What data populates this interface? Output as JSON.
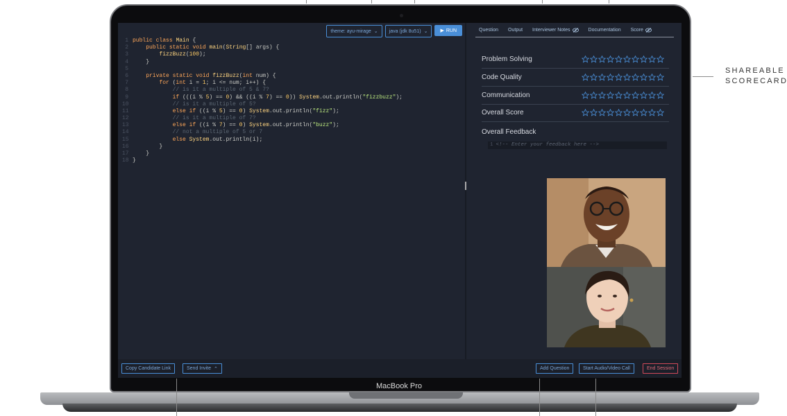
{
  "callouts": {
    "right_label_line1": "SHAREABLE",
    "right_label_line2": "SCORECARDS"
  },
  "device": {
    "brand": "MacBook Pro"
  },
  "editor": {
    "theme_select": "theme: ayu-mirage",
    "language_select": "java (jdk 8u51)",
    "run_label": "RUN",
    "lines": [
      {
        "n": "1",
        "t": "public class Main {"
      },
      {
        "n": "2",
        "t": "    public static void main(String[] args) {"
      },
      {
        "n": "3",
        "t": "        fizzBuzz(100);"
      },
      {
        "n": "4",
        "t": "    }"
      },
      {
        "n": "5",
        "t": ""
      },
      {
        "n": "6",
        "t": "    private static void fizzBuzz(int num) {"
      },
      {
        "n": "7",
        "t": "        for (int i = 1; i <= num; i++) {"
      },
      {
        "n": "8",
        "t": "            // is it a multiple of 5 & 7?"
      },
      {
        "n": "9",
        "t": "            if (((i % 5) == 0) && ((i % 7) == 0)) System.out.println(\"fizzbuzz\");"
      },
      {
        "n": "10",
        "t": "            // is it a multiple of 5?"
      },
      {
        "n": "11",
        "t": "            else if ((i % 5) == 0) System.out.println(\"fizz\");"
      },
      {
        "n": "12",
        "t": "            // is it a multiple of 7?"
      },
      {
        "n": "13",
        "t": "            else if ((i % 7) == 0) System.out.println(\"buzz\");"
      },
      {
        "n": "14",
        "t": "            // not a multiple of 5 or 7"
      },
      {
        "n": "15",
        "t": "            else System.out.println(i);"
      },
      {
        "n": "16",
        "t": "        }"
      },
      {
        "n": "17",
        "t": "    }"
      },
      {
        "n": "18",
        "t": "}"
      }
    ]
  },
  "tabs": [
    {
      "label": "Question",
      "icon": ""
    },
    {
      "label": "Output",
      "icon": ""
    },
    {
      "label": "Interviewer Notes",
      "icon": "eye-slash-icon"
    },
    {
      "label": "Documentation",
      "icon": ""
    },
    {
      "label": "Score",
      "icon": "eye-slash-icon"
    }
  ],
  "scorecard": {
    "max_stars": 10,
    "rows": [
      {
        "label": "Problem Solving",
        "rating": 0
      },
      {
        "label": "Code Quality",
        "rating": 0
      },
      {
        "label": "Communication",
        "rating": 0
      },
      {
        "label": "Overall Score",
        "rating": 0
      }
    ],
    "feedback_label": "Overall Feedback",
    "feedback_line_number": "1",
    "feedback_placeholder": "<!-- Enter your feedback here -->"
  },
  "bottom": {
    "copy_link": "Copy Candidate Link",
    "send_invite": "Send Invite",
    "add_question": "Add Question",
    "start_call": "Start Audio/Video Call",
    "end_session": "End Session"
  },
  "colors": {
    "accent": "#4a8fd8",
    "danger": "#d24a5a",
    "editor_bg": "#1f2430",
    "star": "#4a8fd8"
  }
}
